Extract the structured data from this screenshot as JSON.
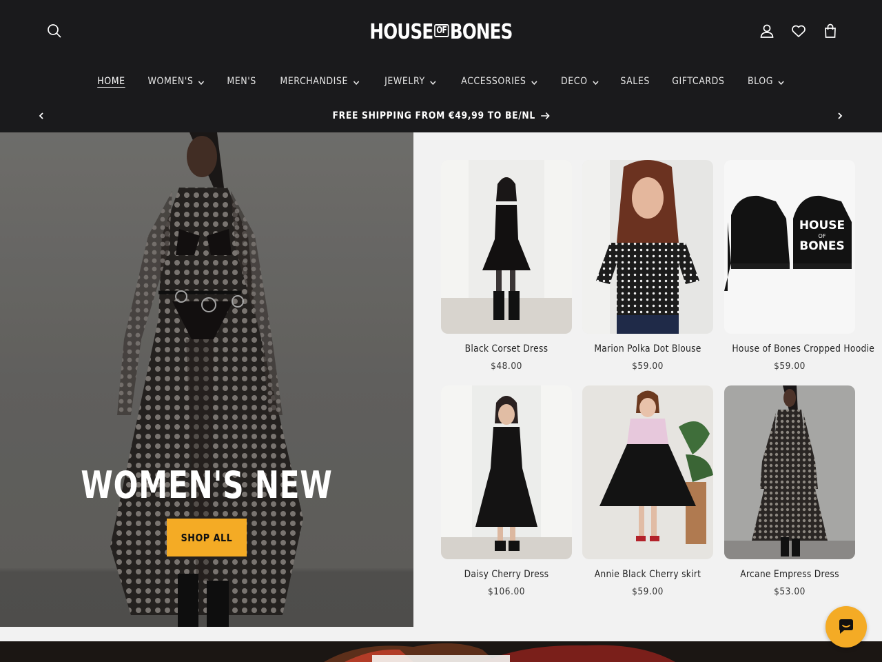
{
  "brand": {
    "logo_main": "HOUSE",
    "logo_of": "OF",
    "logo_end": "BONES"
  },
  "header": {
    "search_icon": "search-icon",
    "account_icon": "user-icon",
    "wishlist_icon": "heart-icon",
    "cart_icon": "cart-icon"
  },
  "nav": {
    "items": [
      {
        "label": "HOME",
        "dropdown": false,
        "active": true
      },
      {
        "label": "WOMEN'S",
        "dropdown": true
      },
      {
        "label": "MEN'S",
        "dropdown": false
      },
      {
        "label": "MERCHANDISE",
        "dropdown": true
      },
      {
        "label": "JEWELRY",
        "dropdown": true
      },
      {
        "label": "ACCESSORIES",
        "dropdown": true
      },
      {
        "label": "DECO",
        "dropdown": true
      },
      {
        "label": "SALES",
        "dropdown": false
      },
      {
        "label": "GIFTCARDS",
        "dropdown": false
      },
      {
        "label": "BLOG",
        "dropdown": true
      }
    ]
  },
  "announcement": {
    "text": "FREE SHIPPING FROM €49,99 TO BE/NL"
  },
  "hero": {
    "title": "WOMEN'S NEW",
    "button_label": "SHOP ALL"
  },
  "products": [
    {
      "title": "Black Corset Dress",
      "price": "$48.00"
    },
    {
      "title": "Marion Polka Dot Blouse",
      "price": "$59.00"
    },
    {
      "title": "House of Bones Cropped Hoodie",
      "price": "$59.00"
    },
    {
      "title": "Daisy Cherry Dress",
      "price": "$106.00"
    },
    {
      "title": "Annie Black Cherry skirt",
      "price": "$59.00"
    },
    {
      "title": "Arcane Empress Dress",
      "price": "$53.00"
    }
  ],
  "colors": {
    "header_bg": "#1a1a1c",
    "accent": "#f4ab25",
    "products_bg": "#f2f2f2"
  }
}
